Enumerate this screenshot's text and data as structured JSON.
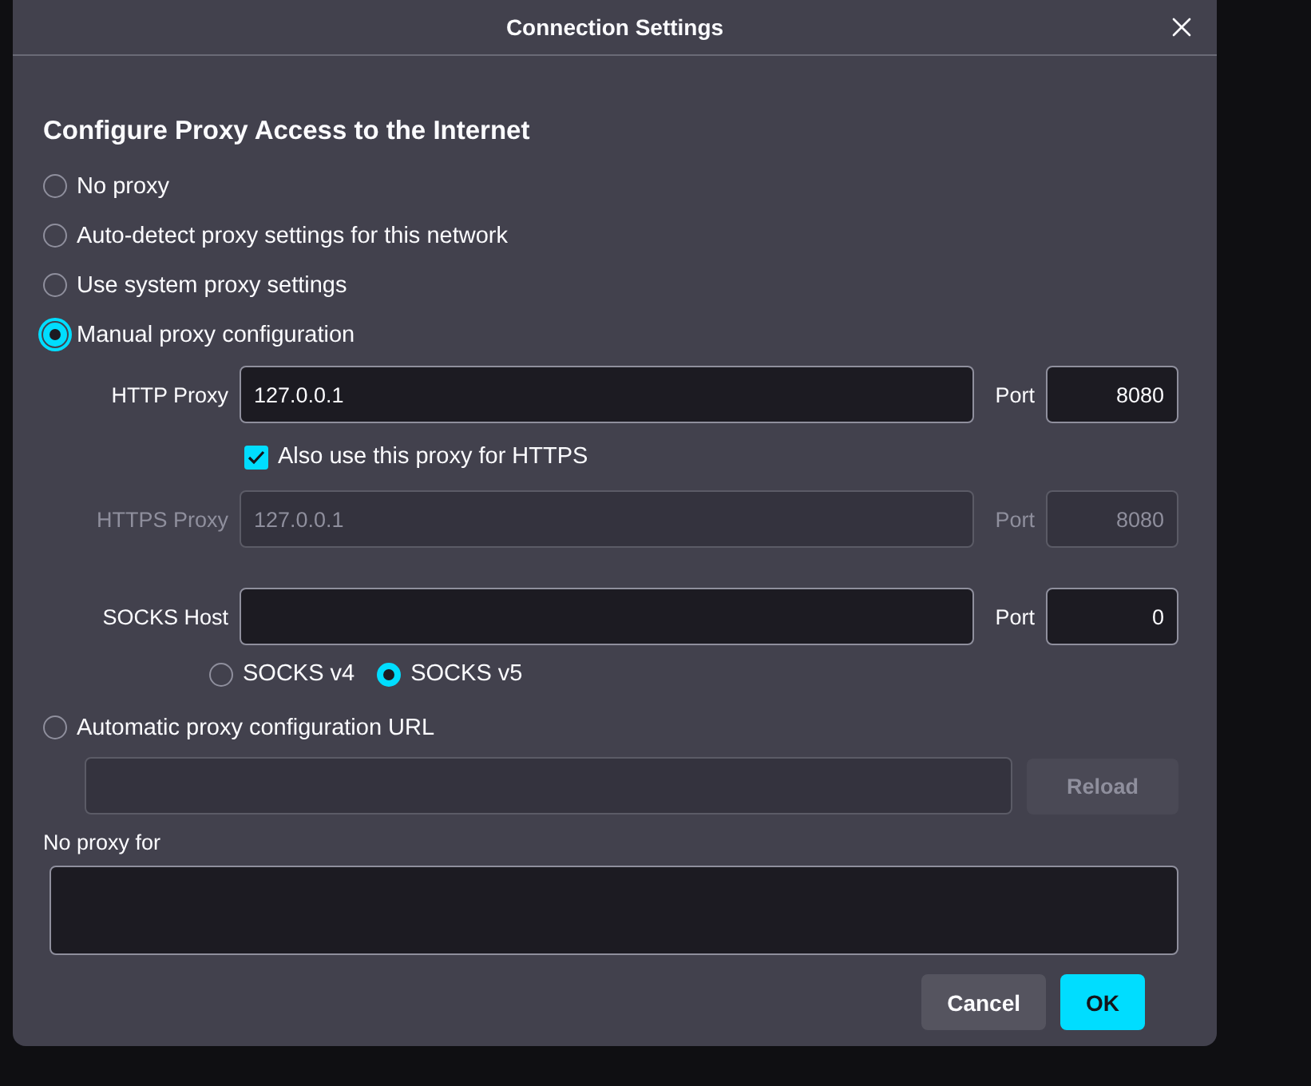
{
  "dialog": {
    "title": "Connection Settings"
  },
  "heading": "Configure Proxy Access to the Internet",
  "modes": [
    {
      "label": "No proxy",
      "selected": false,
      "focused": false
    },
    {
      "label": "Auto-detect proxy settings for this network",
      "selected": false,
      "focused": false
    },
    {
      "label": "Use system proxy settings",
      "selected": false,
      "focused": false
    },
    {
      "label": "Manual proxy configuration",
      "selected": true,
      "focused": true
    }
  ],
  "http": {
    "label": "HTTP Proxy",
    "value": "127.0.0.1",
    "disabled": false,
    "port_label": "Port",
    "port": "8080"
  },
  "also_use": {
    "label": "Also use this proxy for HTTPS",
    "checked": true
  },
  "https": {
    "label": "HTTPS Proxy",
    "value": "127.0.0.1",
    "disabled": true,
    "port_label": "Port",
    "port": "8080"
  },
  "socks": {
    "label": "SOCKS Host",
    "disabled": false,
    "port_label": "Port",
    "port": "0"
  },
  "socks_versions": [
    {
      "label": "SOCKS v4",
      "selected": false
    },
    {
      "label": "SOCKS v5",
      "selected": true
    }
  ],
  "auto": {
    "label": "Automatic proxy configuration URL",
    "selected": false,
    "reload": {
      "label": "Reload",
      "disabled": true
    }
  },
  "no_proxy_for": {
    "label": "No proxy for"
  },
  "buttons": [
    {
      "label": "Cancel",
      "kind": "secondary"
    },
    {
      "label": "OK",
      "kind": "primary"
    }
  ]
}
